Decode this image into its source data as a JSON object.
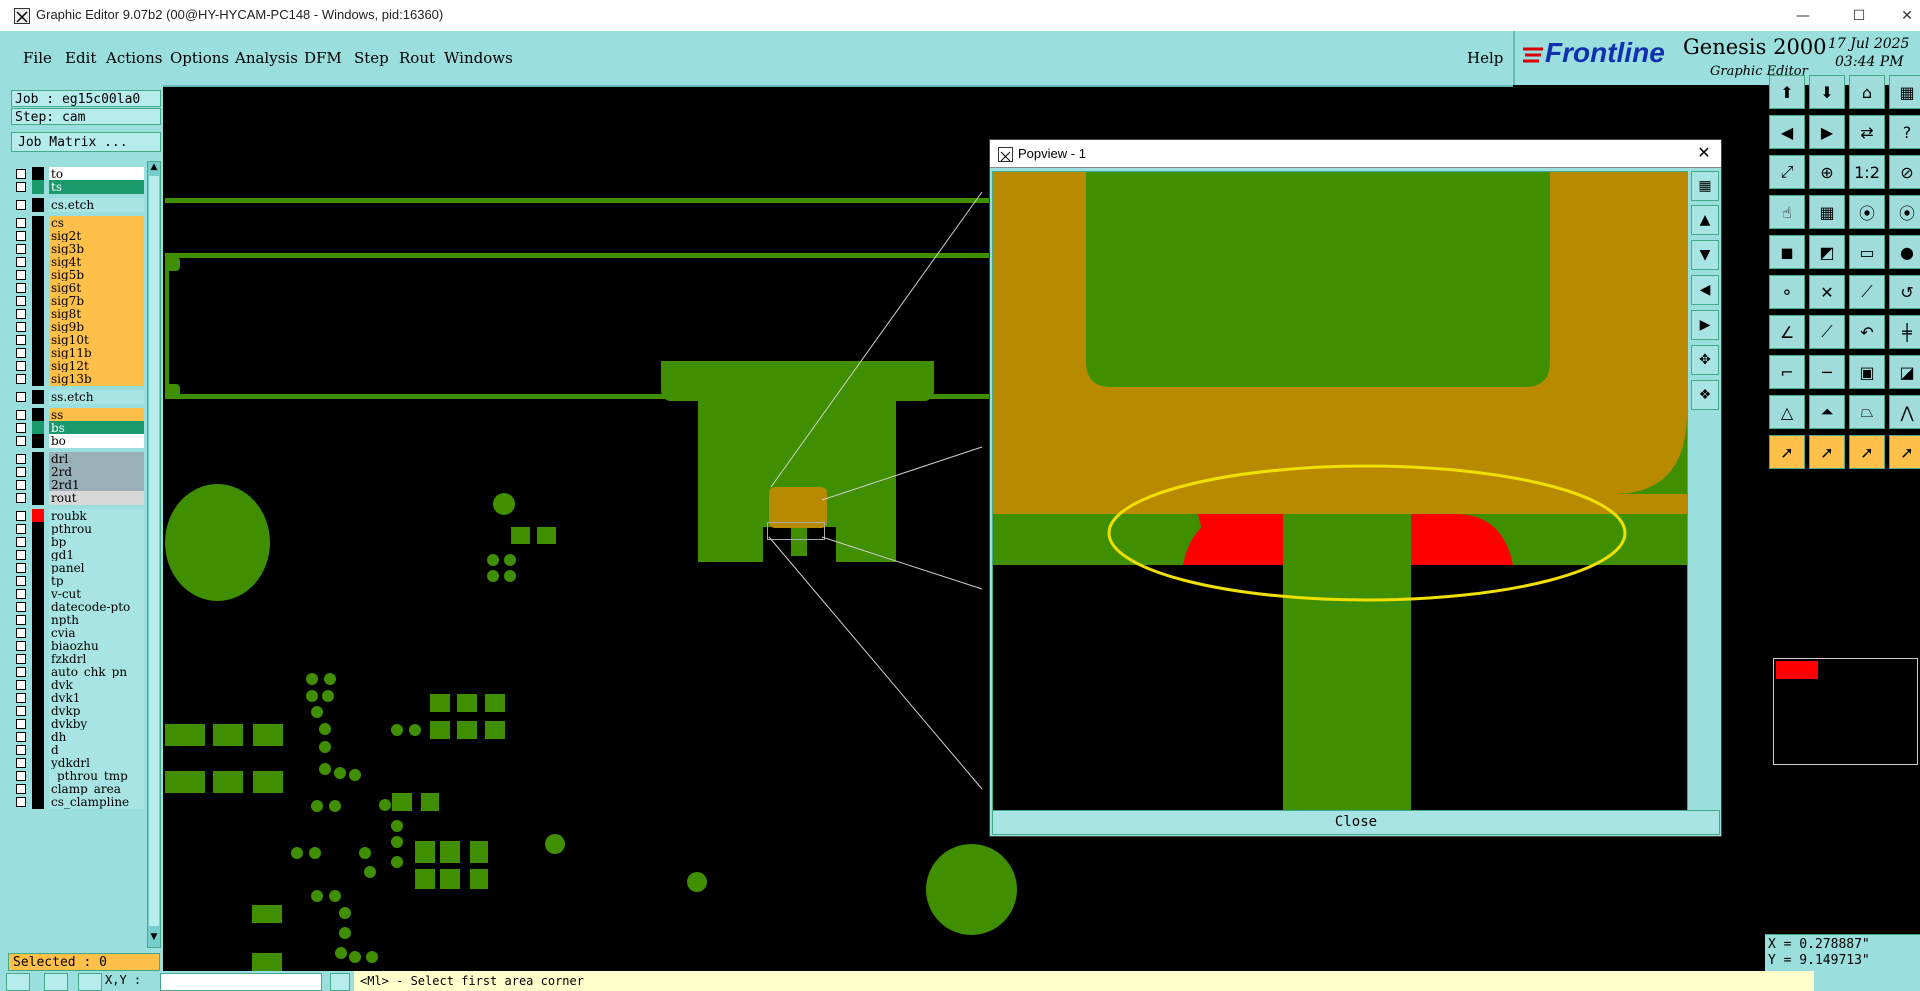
{
  "window": {
    "title": "Graphic Editor 9.07b2 (00@HY-HYCAM-PC148 - Windows, pid:16360)"
  },
  "menu": {
    "items": [
      "File",
      "Edit",
      "Actions",
      "Options",
      "Analysis",
      "DFM",
      "Step",
      "Rout",
      "Windows"
    ],
    "help": "Help"
  },
  "brand": {
    "logo": "Frontline",
    "product": "Genesis 2000",
    "subtitle": "Graphic Editor",
    "date": "17 Jul 2025",
    "time": "03:44 PM"
  },
  "job": {
    "name": "Job : eg15c00la0",
    "step": "Step: cam",
    "matrix_button": "Job Matrix ..."
  },
  "layers": [
    {
      "name": "to",
      "color": "#ffffff",
      "swatch": "#000000"
    },
    {
      "name": "ts",
      "color": "#1a9a6a",
      "swatch": "#1a9a6a"
    },
    {
      "name": "cs.etch",
      "color": "#a8e4e4",
      "swatch": "#000000",
      "sep": true
    },
    {
      "name": "cs",
      "color": "#ffc04a",
      "swatch": "#000000",
      "sep": true
    },
    {
      "name": "sig2t",
      "color": "#ffc04a",
      "swatch": "#000000"
    },
    {
      "name": "sig3b",
      "color": "#ffc04a",
      "swatch": "#000000"
    },
    {
      "name": "sig4t",
      "color": "#ffc04a",
      "swatch": "#000000"
    },
    {
      "name": "sig5b",
      "color": "#ffc04a",
      "swatch": "#000000"
    },
    {
      "name": "sig6t",
      "color": "#ffc04a",
      "swatch": "#000000"
    },
    {
      "name": "sig7b",
      "color": "#ffc04a",
      "swatch": "#000000"
    },
    {
      "name": "sig8t",
      "color": "#ffc04a",
      "swatch": "#000000"
    },
    {
      "name": "sig9b",
      "color": "#ffc04a",
      "swatch": "#000000"
    },
    {
      "name": "sig10t",
      "color": "#ffc04a",
      "swatch": "#000000"
    },
    {
      "name": "sig11b",
      "color": "#ffc04a",
      "swatch": "#000000"
    },
    {
      "name": "sig12t",
      "color": "#ffc04a",
      "swatch": "#000000"
    },
    {
      "name": "sig13b",
      "color": "#ffc04a",
      "swatch": "#000000"
    },
    {
      "name": "ss.etch",
      "color": "#a8e4e4",
      "swatch": "#000000",
      "sep": true
    },
    {
      "name": "ss",
      "color": "#ffc04a",
      "swatch": "#000000",
      "sep": true
    },
    {
      "name": "bs",
      "color": "#1a9a6a",
      "swatch": "#1a9a6a"
    },
    {
      "name": "bo",
      "color": "#ffffff",
      "swatch": "#000000"
    },
    {
      "name": "drl",
      "color": "#9ab0b8",
      "swatch": "#000000",
      "sep": true
    },
    {
      "name": "2rd",
      "color": "#9ab0b8",
      "swatch": "#000000"
    },
    {
      "name": "2rd1",
      "color": "#9ab0b8",
      "swatch": "#000000"
    },
    {
      "name": "rout",
      "color": "#d8d8d8",
      "swatch": "#000000"
    },
    {
      "name": "roubk",
      "color": "#a8e4e4",
      "swatch": "#ff0000",
      "sep": true
    },
    {
      "name": "pthrou",
      "color": "#a8e4e4",
      "swatch": "#000000"
    },
    {
      "name": "bp",
      "color": "#a8e4e4",
      "swatch": "#000000"
    },
    {
      "name": "gd1",
      "color": "#a8e4e4",
      "swatch": "#000000"
    },
    {
      "name": "panel",
      "color": "#a8e4e4",
      "swatch": "#000000"
    },
    {
      "name": "tp",
      "color": "#a8e4e4",
      "swatch": "#000000"
    },
    {
      "name": "v-cut",
      "color": "#a8e4e4",
      "swatch": "#000000"
    },
    {
      "name": "datecode-pto",
      "color": "#a8e4e4",
      "swatch": "#000000"
    },
    {
      "name": "npth",
      "color": "#a8e4e4",
      "swatch": "#000000"
    },
    {
      "name": "cvia",
      "color": "#a8e4e4",
      "swatch": "#000000"
    },
    {
      "name": "biaozhu",
      "color": "#a8e4e4",
      "swatch": "#000000"
    },
    {
      "name": "fzkdrl",
      "color": "#a8e4e4",
      "swatch": "#000000"
    },
    {
      "name": "auto_chk_pn",
      "color": "#a8e4e4",
      "swatch": "#000000"
    },
    {
      "name": "dvk",
      "color": "#a8e4e4",
      "swatch": "#000000"
    },
    {
      "name": "dvk1",
      "color": "#a8e4e4",
      "swatch": "#000000"
    },
    {
      "name": "dvkp",
      "color": "#a8e4e4",
      "swatch": "#000000"
    },
    {
      "name": "dvkby",
      "color": "#a8e4e4",
      "swatch": "#000000"
    },
    {
      "name": "dh",
      "color": "#a8e4e4",
      "swatch": "#000000"
    },
    {
      "name": "d",
      "color": "#a8e4e4",
      "swatch": "#000000"
    },
    {
      "name": "ydkdrl",
      "color": "#a8e4e4",
      "swatch": "#000000"
    },
    {
      "name": "_pthrou_tmp",
      "color": "#a8e4e4",
      "swatch": "#000000"
    },
    {
      "name": "clamp_area",
      "color": "#a8e4e4",
      "swatch": "#000000"
    },
    {
      "name": "cs_clampline",
      "color": "#a8e4e4",
      "swatch": "#000000"
    }
  ],
  "selected": "Selected : 0",
  "popview": {
    "title": "Popview - 1",
    "close_label": "Close"
  },
  "coords": {
    "x": "X = 0.278887\"",
    "y": "Y = 9.149713\""
  },
  "status": {
    "xy_label": "X,Y :",
    "prompt": "<Ml> - Select first area corner"
  }
}
